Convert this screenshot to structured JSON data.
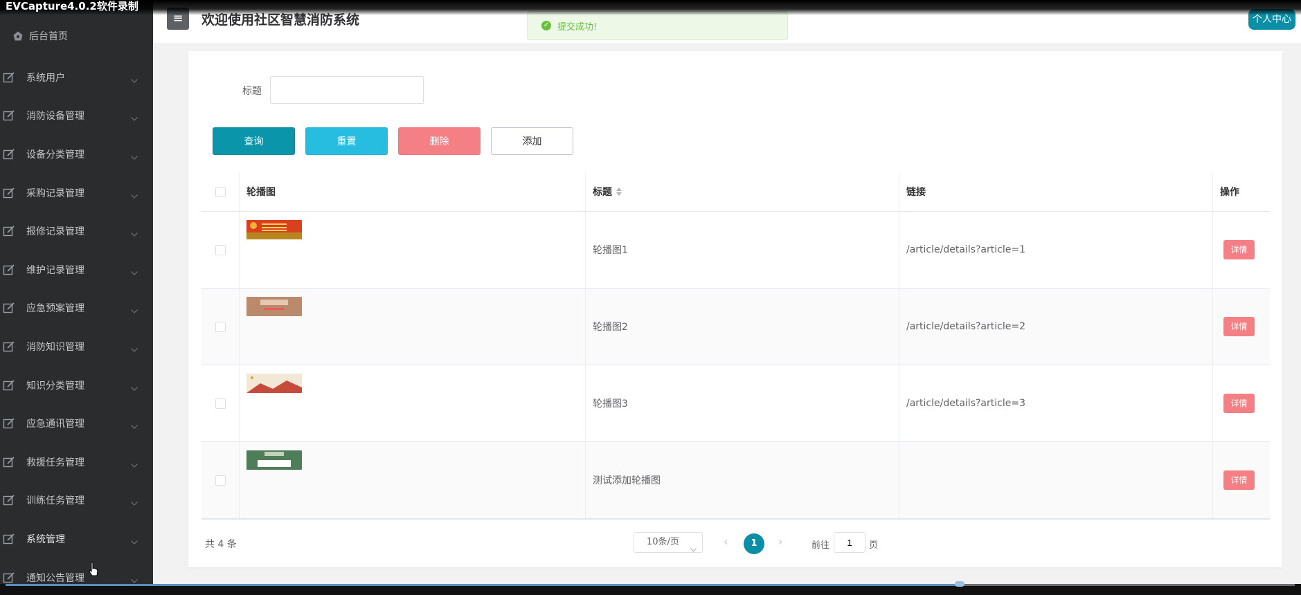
{
  "recorder": {
    "title": "EVCapture4.0.2软件录制",
    "progress_fraction": 0.74
  },
  "sidebar": {
    "home_label": "后台首页",
    "items": [
      {
        "label": "系统用户"
      },
      {
        "label": "消防设备管理"
      },
      {
        "label": "设备分类管理"
      },
      {
        "label": "采购记录管理"
      },
      {
        "label": "报修记录管理"
      },
      {
        "label": "维护记录管理"
      },
      {
        "label": "应急预案管理"
      },
      {
        "label": "消防知识管理"
      },
      {
        "label": "知识分类管理"
      },
      {
        "label": "应急通讯管理"
      },
      {
        "label": "救援任务管理"
      },
      {
        "label": "训练任务管理"
      },
      {
        "label": "系统管理"
      },
      {
        "label": "通知公告管理"
      }
    ]
  },
  "header": {
    "menu_icon": "≡",
    "title": "欢迎使用社区智慧消防系统",
    "user_center": "个人中心"
  },
  "toast": {
    "message": "提交成功!",
    "icon": "check-circle-icon"
  },
  "search": {
    "label": "标题",
    "value": "",
    "placeholder": ""
  },
  "actions": {
    "query": "查询",
    "reset": "重置",
    "delete": "删除",
    "add": "添加"
  },
  "table": {
    "columns": {
      "image": "轮播图",
      "title": "标题",
      "link": "链接",
      "operation": "操作"
    },
    "rows": [
      {
        "title": "轮播图1",
        "link": "/article/details?article=1",
        "detail": "详情"
      },
      {
        "title": "轮播图2",
        "link": "/article/details?article=2",
        "detail": "详情"
      },
      {
        "title": "轮播图3",
        "link": "/article/details?article=3",
        "detail": "详情"
      },
      {
        "title": "测试添加轮播图",
        "link": "",
        "detail": "详情"
      }
    ]
  },
  "pagination": {
    "total": "共 4 条",
    "page_size": "10条/页",
    "current_page": "1",
    "goto_prefix": "前往",
    "goto_value": "1",
    "goto_suffix": "页"
  },
  "colors": {
    "primary": "#0b8ea6",
    "reset": "#27bde0",
    "danger": "#f48085",
    "sidebar_bg": "#2b2c2d",
    "success": "#67c23a"
  }
}
